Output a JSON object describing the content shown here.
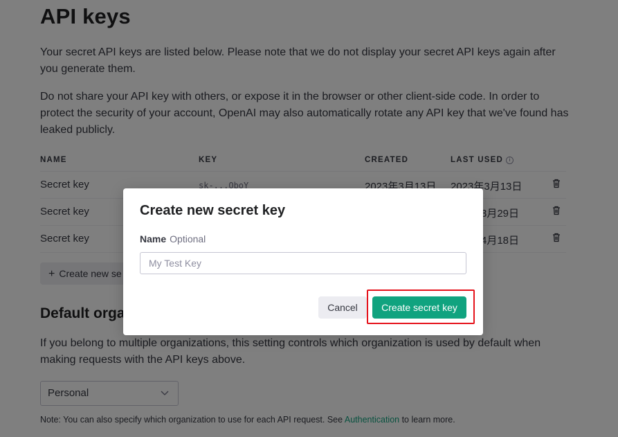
{
  "page": {
    "title": "API keys",
    "intro": "Your secret API keys are listed below. Please note that we do not display your secret API keys again after you generate them.",
    "warning": "Do not share your API key with others, or expose it in the browser or other client-side code. In order to protect the security of your account, OpenAI may also automatically rotate any API key that we've found has leaked publicly."
  },
  "table": {
    "headers": {
      "name": "NAME",
      "key": "KEY",
      "created": "CREATED",
      "last_used": "LAST USED",
      "last_used_info_icon": "info-icon"
    },
    "rows": [
      {
        "name": "Secret key",
        "key": "sk-...QboY",
        "created": "2023年3月13日",
        "last_used": "2023年3月13日",
        "delete_icon": "trash-icon"
      },
      {
        "name": "Secret key",
        "key": "",
        "created": "",
        "last_used": "3月29日",
        "delete_icon": "trash-icon"
      },
      {
        "name": "Secret key",
        "key": "",
        "created": "",
        "last_used": "4月18日",
        "delete_icon": "trash-icon"
      }
    ]
  },
  "create_button": {
    "icon": "plus-icon",
    "label": "Create new se"
  },
  "default_org": {
    "title": "Default organ",
    "description": "If you belong to multiple organizations, this setting controls which organization is used by default when making requests with the API keys above.",
    "select_value": "Personal",
    "select_icon": "chevron-down-icon"
  },
  "note": {
    "prefix": "Note: You can also specify which organization to use for each API request. See ",
    "link": "Authentication",
    "suffix": " to learn more."
  },
  "modal": {
    "title": "Create new secret key",
    "field_label": "Name",
    "field_optional": "Optional",
    "input_placeholder": "My Test Key",
    "input_value": "",
    "cancel_label": "Cancel",
    "submit_label": "Create secret key"
  },
  "colors": {
    "accent": "#10a37f",
    "highlight": "#e5121b",
    "overlay": "rgba(0,0,0,0.5)"
  }
}
